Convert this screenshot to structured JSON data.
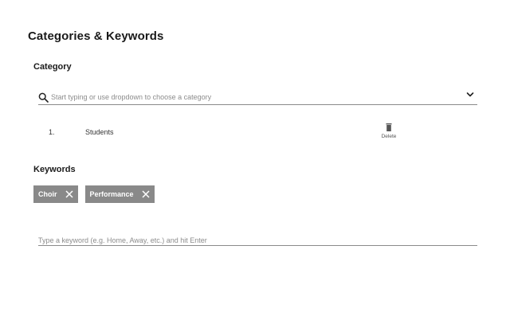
{
  "page": {
    "title": "Categories & Keywords"
  },
  "category_section": {
    "title": "Category",
    "search": {
      "placeholder": "Start typing or use dropdown to choose a category",
      "value": ""
    },
    "items": [
      {
        "index": "1.",
        "name": "Students",
        "delete_label": "Delete"
      }
    ]
  },
  "keywords_section": {
    "title": "Keywords",
    "chips": [
      {
        "label": "Choir"
      },
      {
        "label": "Performance"
      }
    ],
    "input": {
      "placeholder": "Type a keyword (e.g. Home, Away, etc.) and hit Enter",
      "value": ""
    }
  },
  "icons": {
    "search": "search-icon",
    "dropdown": "chevron-down-icon",
    "delete": "trash-icon",
    "chip_remove": "close-icon"
  },
  "colors": {
    "chip_background": "#898989",
    "chip_text": "#ffffff",
    "underline": "#8a8a8a",
    "placeholder": "#8c8c8c"
  }
}
